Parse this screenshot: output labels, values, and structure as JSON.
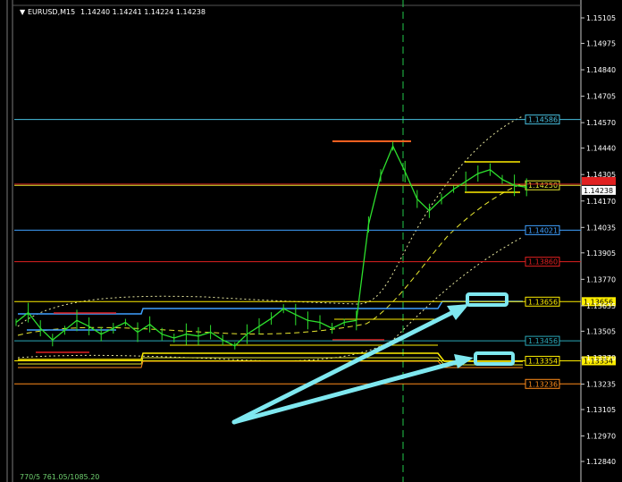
{
  "header": {
    "symbol": "EURUSD,M15",
    "ohlc": "1.14240 1.14241 1.14224 1.14238",
    "footer_text": "770/5 761.05/1085.20"
  },
  "chart_data": {
    "type": "line",
    "symbol": "EURUSD",
    "timeframe": "M15",
    "ylim": [
      1.1278,
      1.1514
    ],
    "grid": false,
    "y_ticks": [
      "1.15105",
      "1.14975",
      "1.14840",
      "1.14705",
      "1.14570",
      "1.14440",
      "1.14305",
      "1.14170",
      "1.14035",
      "1.13905",
      "1.13770",
      "1.13635",
      "1.13505",
      "1.13370",
      "1.13235",
      "1.13105",
      "1.12970",
      "1.12840"
    ],
    "current_price": "1.14238",
    "levels": [
      {
        "price": 1.14586,
        "label": "1.14586",
        "color": "#48c0e0"
      },
      {
        "price": 1.1425,
        "label": "1.14250",
        "color": "#e8e830"
      },
      {
        "price": 1.14021,
        "label": "1.14021",
        "color": "#3fa0ff"
      },
      {
        "price": 1.1386,
        "label": "1.13860",
        "color": "#e02020"
      },
      {
        "price": 1.13656,
        "label": "1.13656",
        "color": "#ffee00"
      },
      {
        "price": 1.13456,
        "label": "1.13456",
        "color": "#2aa8b8"
      },
      {
        "price": 1.13354,
        "label": "1.13354",
        "color": "#ffee00"
      },
      {
        "price": 1.13236,
        "label": "1.13236",
        "color": "#ff8c1a"
      }
    ],
    "price_series": [
      {
        "x": 0,
        "y": 1.1355
      },
      {
        "x": 2,
        "y": 1.136
      },
      {
        "x": 4,
        "y": 1.1352
      },
      {
        "x": 6,
        "y": 1.1346
      },
      {
        "x": 8,
        "y": 1.1351
      },
      {
        "x": 10,
        "y": 1.1356
      },
      {
        "x": 12,
        "y": 1.1353
      },
      {
        "x": 14,
        "y": 1.1349
      },
      {
        "x": 16,
        "y": 1.1352
      },
      {
        "x": 18,
        "y": 1.1355
      },
      {
        "x": 20,
        "y": 1.135
      },
      {
        "x": 22,
        "y": 1.1354
      },
      {
        "x": 24,
        "y": 1.1349
      },
      {
        "x": 26,
        "y": 1.1347
      },
      {
        "x": 28,
        "y": 1.1349
      },
      {
        "x": 30,
        "y": 1.1348
      },
      {
        "x": 32,
        "y": 1.135
      },
      {
        "x": 34,
        "y": 1.1346
      },
      {
        "x": 36,
        "y": 1.1343
      },
      {
        "x": 38,
        "y": 1.1349
      },
      {
        "x": 40,
        "y": 1.1353
      },
      {
        "x": 42,
        "y": 1.1357
      },
      {
        "x": 44,
        "y": 1.1362
      },
      {
        "x": 46,
        "y": 1.1359
      },
      {
        "x": 48,
        "y": 1.1356
      },
      {
        "x": 50,
        "y": 1.1355
      },
      {
        "x": 52,
        "y": 1.1352
      },
      {
        "x": 54,
        "y": 1.1355
      },
      {
        "x": 56,
        "y": 1.1356
      },
      {
        "x": 58,
        "y": 1.1405
      },
      {
        "x": 60,
        "y": 1.143
      },
      {
        "x": 62,
        "y": 1.1445
      },
      {
        "x": 64,
        "y": 1.1432
      },
      {
        "x": 66,
        "y": 1.1418
      },
      {
        "x": 68,
        "y": 1.1412
      },
      {
        "x": 70,
        "y": 1.1418
      },
      {
        "x": 72,
        "y": 1.1423
      },
      {
        "x": 74,
        "y": 1.1427
      },
      {
        "x": 76,
        "y": 1.1431
      },
      {
        "x": 78,
        "y": 1.1433
      },
      {
        "x": 80,
        "y": 1.1428
      },
      {
        "x": 82,
        "y": 1.1425
      },
      {
        "x": 84,
        "y": 1.1424
      }
    ],
    "x_range": [
      0,
      100
    ]
  }
}
